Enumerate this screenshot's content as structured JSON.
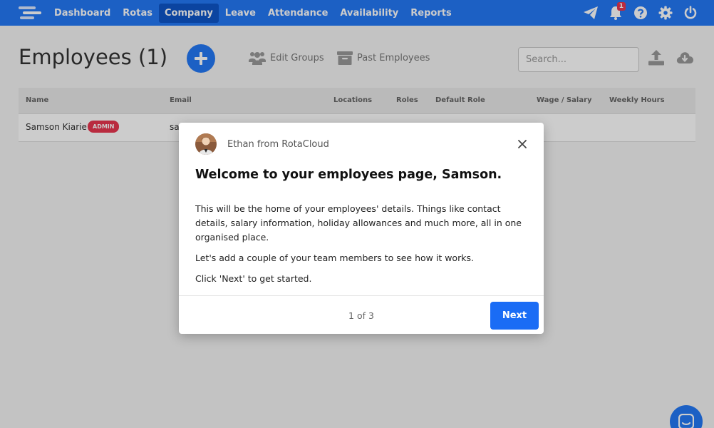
{
  "nav": {
    "items": [
      {
        "label": "Dashboard",
        "active": false
      },
      {
        "label": "Rotas",
        "active": false
      },
      {
        "label": "Company",
        "active": true
      },
      {
        "label": "Leave",
        "active": false
      },
      {
        "label": "Attendance",
        "active": false
      },
      {
        "label": "Availability",
        "active": false
      },
      {
        "label": "Reports",
        "active": false
      }
    ],
    "icons": [
      "send-icon",
      "bell-icon",
      "help-icon",
      "gear-icon",
      "power-icon"
    ],
    "notification_count": "1"
  },
  "page": {
    "title": "Employees (1)",
    "edit_groups_label": "Edit Groups",
    "past_employees_label": "Past Employees",
    "search_placeholder": "Search..."
  },
  "table": {
    "columns": [
      "Name",
      "Email",
      "Locations",
      "Roles",
      "Default Role",
      "Wage / Salary",
      "Weekly Hours"
    ],
    "rows": [
      {
        "name": "Samson Kiarie",
        "badge": "ADMIN",
        "email_visible": "sa"
      }
    ]
  },
  "modal": {
    "sender": "Ethan from RotaCloud",
    "title": "Welcome to your employees page, Samson.",
    "paragraphs": [
      "This will be the home of your employees' details. Things like contact details, salary information, holiday allowances and much more, all in one organised place.",
      "Let's add a couple of your team members to see how it works.",
      "Click 'Next' to get started."
    ],
    "step": "1 of 3",
    "next_label": "Next"
  },
  "colors": {
    "brand_blue": "#2478f5",
    "active_nav": "#0e55c8",
    "admin_badge": "#e8364f",
    "next_button": "#1a6cf5"
  }
}
